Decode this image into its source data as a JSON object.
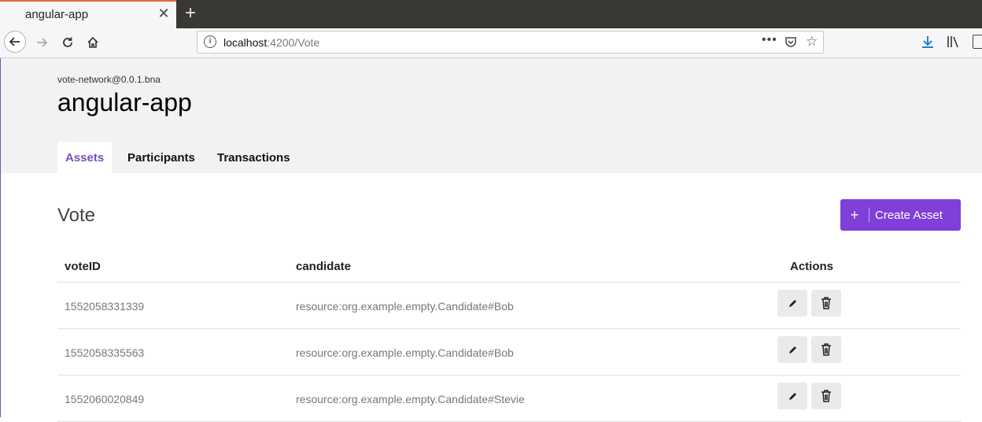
{
  "browser": {
    "tab_title": "angular-app",
    "tab_close": "✕",
    "new_tab": "+",
    "url_host": "localhost",
    "url_path": ":4200/Vote",
    "url_menu": "•••",
    "bookmark_star": "☆"
  },
  "header": {
    "network_id": "vote-network@0.0.1.bna",
    "app_title": "angular-app",
    "tabs": [
      {
        "label": "Assets",
        "active": true
      },
      {
        "label": "Participants",
        "active": false
      },
      {
        "label": "Transactions",
        "active": false
      }
    ]
  },
  "main": {
    "title": "Vote",
    "create_button": {
      "icon": "+",
      "label": "Create Asset"
    },
    "table": {
      "columns": [
        "voteID",
        "candidate",
        "Actions"
      ],
      "rows": [
        {
          "voteID": "1552058331339",
          "candidate": "resource:org.example.empty.Candidate#Bob"
        },
        {
          "voteID": "1552058335563",
          "candidate": "resource:org.example.empty.Candidate#Bob"
        },
        {
          "voteID": "1552060020849",
          "candidate": "resource:org.example.empty.Candidate#Stevie"
        }
      ]
    }
  },
  "colors": {
    "accent": "#7f3fd9",
    "active_tab_text": "#7b4fbe"
  }
}
